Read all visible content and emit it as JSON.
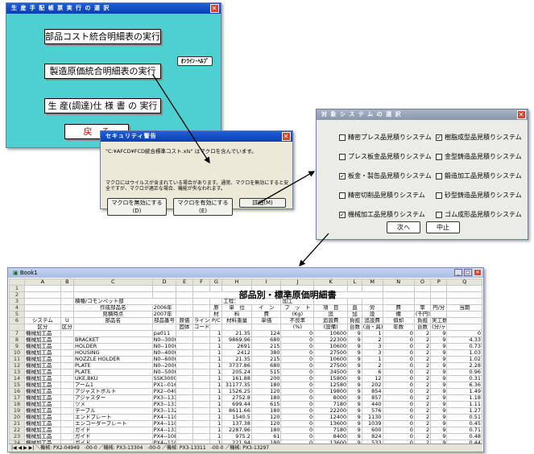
{
  "win_main": {
    "title": "生 産 手 配 帳 票 実 行 の 選 択",
    "btn1": "部品コスト統合明細表の実行",
    "btn2": "製造原価統合明細表の実行",
    "btn3": "生 産(調達)仕 様 書 の 実行",
    "btn4": "戻　る",
    "help": "ｵﾝﾗｲﾝ･ﾍﾙﾌﾟ"
  },
  "win_security": {
    "title": "セキュリティ警告",
    "file_line": "\"C:¥AFCD¥FCD統合標準コスト.xls\" はマクロを含んでいます。",
    "warning": "マクロにはウイルスが含まれている場合があります。通常、マクロを無効にすると安全ですが、マクロが適正な場合、機能が失なわれます。",
    "btn_disable": "マクロを無効にする(D)",
    "btn_enable": "マクロを有効にする(E)",
    "btn_details": "詳細(M)"
  },
  "win_target": {
    "title": "対 象 シ ス テ ム の 選 択",
    "left": [
      {
        "label": "精密プレス品見積りシステム",
        "checked": false
      },
      {
        "label": "プレス板金品見積りシステム",
        "checked": false
      },
      {
        "label": "板金・製缶品見積りシステム",
        "checked": true
      },
      {
        "label": "精密切削品見積りシステム",
        "checked": false
      },
      {
        "label": "機械加工品見積りシステム",
        "checked": true
      }
    ],
    "right": [
      {
        "label": "樹脂成型品見積りシステム",
        "checked": true
      },
      {
        "label": "金型鋳造品見積りシステム",
        "checked": false
      },
      {
        "label": "鍛造加工品見積りシステム",
        "checked": false
      },
      {
        "label": "砂型鋳造品見積りシステム",
        "checked": false
      },
      {
        "label": "ゴム成形品見積りシステム",
        "checked": false
      }
    ],
    "next": "次へ",
    "stop": "中止"
  },
  "sheet": {
    "title": "Book1",
    "heading": "部品別・標準原価明細書",
    "cols": [
      "",
      "A",
      "B",
      "C",
      "D",
      "E",
      "F",
      "G",
      "H",
      "I",
      "J",
      "K",
      "L",
      "M",
      "N",
      "O",
      "P",
      "Q"
    ],
    "meta": [
      {
        "label": "積種/コモンペット部",
        "k": "工程：",
        "v": "加工"
      },
      {
        "label": "作成部品名",
        "v": "2006年"
      },
      {
        "label": "見積時点",
        "v": "2007年"
      }
    ],
    "hdr1": [
      "システム",
      "U",
      "部品名",
      "部品番号",
      "原価",
      "ライン",
      "P/C",
      "材料重量",
      "単価",
      "不良率",
      "追設費",
      "負担",
      "追設費",
      "償却",
      "負担",
      "実工数"
    ],
    "hdr2": [
      "区分",
      "区分",
      "",
      "",
      "固体",
      "コード",
      "",
      "",
      "",
      "(%)",
      "(設備)",
      "台数",
      "(治・具)",
      "年数",
      "台数",
      "(分/ヶ)"
    ],
    "group_hdr": [
      "原",
      "単　位",
      "イ　ン",
      "プ　ッ　ト",
      "項　目",
      "直",
      "労",
      "費",
      "率",
      "円/分",
      "当期"
    ],
    "group_hdr2": [
      "材",
      "料",
      "費",
      "(Kg)",
      "追",
      "加",
      "設",
      "備",
      "(千円)",
      ""
    ],
    "rows": [
      [
        "機械加工品",
        "",
        "",
        "pa011　　--00--0",
        "",
        "",
        "1",
        "21.35",
        "124",
        "0",
        "10600",
        "9",
        "1",
        "0",
        "2",
        "9",
        "0"
      ],
      [
        "機械加工品",
        "",
        "BRACKET",
        "N0--300000000000--00--0",
        "",
        "",
        "1",
        "9869.96",
        "680",
        "0",
        "22300",
        "9",
        "2",
        "0",
        "2",
        "9",
        "4.33"
      ],
      [
        "機械加工品",
        "",
        "HOLDER",
        "N0--100000000000--00--0",
        "",
        "",
        "1",
        "2691",
        "215",
        "0",
        "10600",
        "9",
        "3",
        "0",
        "2",
        "9",
        "0.73"
      ],
      [
        "機械加工品",
        "",
        "HOUSING",
        "N0--400000000000--00--0",
        "",
        "",
        "1",
        "2412",
        "380",
        "0",
        "27500",
        "9",
        "3",
        "0",
        "2",
        "9",
        "1.03"
      ],
      [
        "機械加工品",
        "",
        "NOZZLE HOLDER",
        "N0--600000000000--00--0",
        "",
        "",
        "1",
        "21.35",
        "215",
        "0",
        "10600",
        "9",
        "1",
        "0",
        "2",
        "9",
        "1.02"
      ],
      [
        "機械加工品",
        "",
        "PLATE",
        "N0--200000000000--00--0",
        "",
        "",
        "1",
        "3737.86",
        "680",
        "0",
        "27500",
        "9",
        "2",
        "0",
        "2",
        "9",
        "2.28"
      ],
      [
        "機械加工品",
        "",
        "PLATE",
        "N0--500000000000--00--0",
        "",
        "",
        "1",
        "205.24",
        "515",
        "0",
        "34500",
        "9",
        "6",
        "0",
        "2",
        "9",
        "0.96"
      ],
      [
        "機械加工品",
        "",
        "UKE,BKU",
        "SSK3000　　--00--0",
        "",
        "",
        "1",
        "161.88",
        "200",
        "0",
        "15800",
        "9",
        "12",
        "0",
        "2",
        "9",
        "0.31"
      ],
      [
        "機械加工品",
        "",
        "アーム1",
        "PX1--01692　--00--0",
        "",
        "",
        "1",
        "31177.35",
        "180",
        "0",
        "12580",
        "9",
        "202",
        "0",
        "2",
        "9",
        "6.36"
      ],
      [
        "機械加工品",
        "",
        "アジャストボルト",
        "PX2--04949　--00--0",
        "",
        "",
        "1",
        "1526.25",
        "120",
        "0",
        "19800",
        "9",
        "854",
        "0",
        "2",
        "9",
        "1.49"
      ],
      [
        "機械加工品",
        "",
        "アジャスター",
        "PX3--13304　--00--0",
        "",
        "",
        "1",
        "2752.8",
        "180",
        "0",
        "8000",
        "9",
        "857",
        "0",
        "2",
        "9",
        "1.18"
      ],
      [
        "機械加工品",
        "",
        "ツメ",
        "PX3--13311　--00--0",
        "",
        "",
        "1",
        "699.44",
        "615",
        "0",
        "7180",
        "9",
        "440",
        "0",
        "2",
        "9",
        "1.11"
      ],
      [
        "機械加工品",
        "",
        "テーブル",
        "PX3--13297　--00--0",
        "",
        "",
        "1",
        "8611.66",
        "180",
        "0",
        "22200",
        "9",
        "576",
        "0",
        "2",
        "9",
        "1.27"
      ],
      [
        "機械加工品",
        "",
        "エンドプレート",
        "PX4--11053　--00--0",
        "",
        "",
        "1",
        "1540.5",
        "120",
        "0",
        "12400",
        "9",
        "1130",
        "0",
        "2",
        "9",
        "0.51"
      ],
      [
        "機械加工品",
        "",
        "エンコーダープレート",
        "PX4--11056　--00--0",
        "",
        "",
        "1",
        "137.38",
        "120",
        "0",
        "13600",
        "9",
        "1039",
        "0",
        "2",
        "9",
        "0.45"
      ],
      [
        "機械加工品",
        "",
        "ガイド",
        "PX4--13318　--00--0",
        "",
        "",
        "1",
        "2287.96",
        "180",
        "0",
        "7180",
        "9",
        "600",
        "0",
        "2",
        "9",
        "0.71"
      ],
      [
        "機械加工品",
        "",
        "ガイド",
        "PX4--10868　--00--0",
        "",
        "",
        "1",
        "975.2",
        "61",
        "0",
        "8400",
        "9",
        "824",
        "0",
        "2",
        "9",
        "0.48"
      ],
      [
        "機械加工品",
        "",
        "ガイド",
        "PX4--11064　--00--0",
        "",
        "",
        "1",
        "221.94",
        "180",
        "0",
        "13600",
        "9",
        "533",
        "0",
        "2",
        "9",
        "0.44"
      ]
    ],
    "tabs": "|◀ ◀ ▶ ▶| ＼機械: PX2-04949　-00-0 ／機械: PX3-13304　-00-0 ／機械: PX3-13311　-00-0 ／機械: PX3-13297"
  }
}
